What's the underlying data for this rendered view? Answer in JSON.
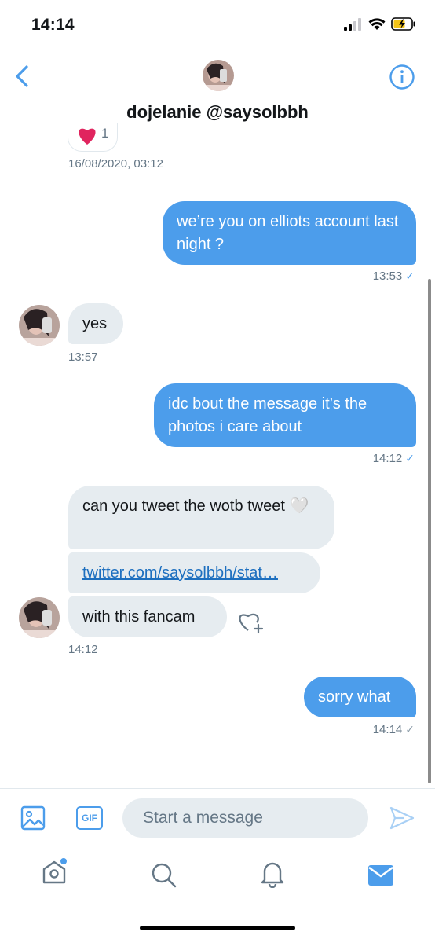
{
  "status": {
    "time": "14:14"
  },
  "header": {
    "title": "dojelanie @saysolbbh"
  },
  "top_reaction_count": "1",
  "top_timestamp": "16/08/2020, 03:12",
  "messages": [
    {
      "dir": "out",
      "text": "we’re you on elliots account last night ?",
      "time": "13:53"
    },
    {
      "dir": "in",
      "text": "yes",
      "time": "13:57"
    },
    {
      "dir": "out",
      "text": "idc bout the message it’s the photos i care about",
      "time": "14:12"
    },
    {
      "dir": "in",
      "text": "can you tweet the wotb tweet 🤍"
    },
    {
      "dir": "in",
      "text": "twitter.com/saysolbbh/stat…"
    },
    {
      "dir": "in",
      "text": "with this fancam",
      "time": "14:12"
    },
    {
      "dir": "out",
      "text": "sorry what",
      "time": "14:14"
    }
  ],
  "composer": {
    "placeholder": "Start a message",
    "gif_label": "GIF"
  },
  "colors": {
    "accent": "#4c9deb",
    "incoming": "#e6ecf0",
    "muted": "#657786"
  }
}
